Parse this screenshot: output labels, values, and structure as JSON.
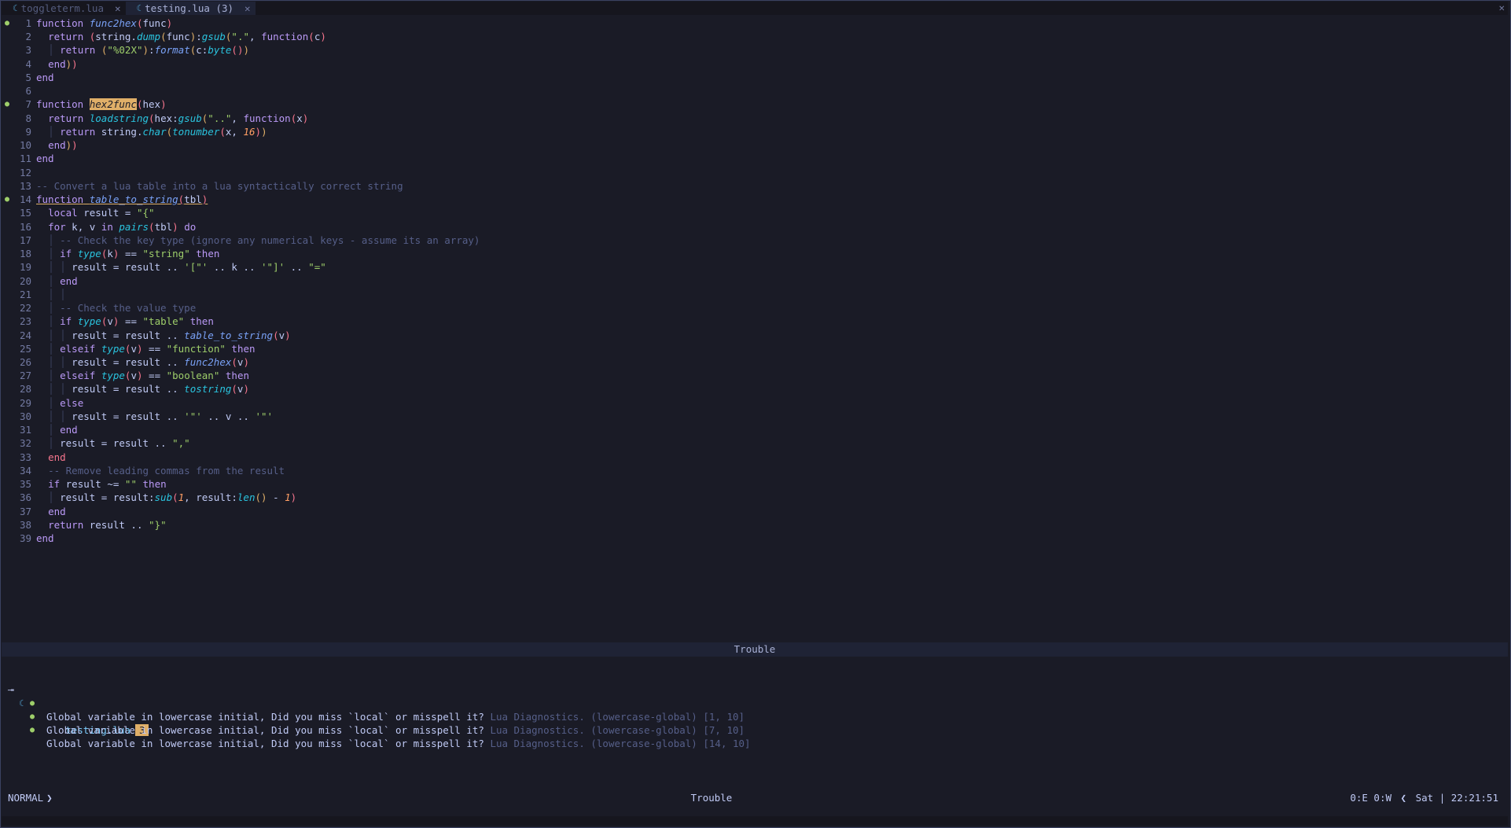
{
  "tabs": [
    {
      "label": "toggleterm.lua",
      "close": "✕",
      "active": false
    },
    {
      "label": "testing.lua (3)",
      "close": "✕",
      "active": true
    }
  ],
  "window_close": "✕",
  "icons": {
    "diagnostic": "info-icon",
    "lua": "lua-file-icon"
  },
  "colors": {
    "bg": "#1a1b26",
    "keyword": "#bb9af7",
    "string": "#9ece6a",
    "function": "#7aa2f7",
    "comment": "#565f89",
    "badge": "#e0af68"
  },
  "code_lines": [
    {
      "n": "1",
      "sign": true,
      "html": "<span class=\"kw\">function</span> <span class=\"fn\">func2hex</span><span class=\"par\">(</span>func<span class=\"par\">)</span>"
    },
    {
      "n": "2",
      "html": "  <span class=\"kw\">return</span> <span class=\"par\">(</span>string.<span class=\"bi\">dump</span><span class=\"brk\">(</span>func<span class=\"brk\">)</span>:<span class=\"bi\">gsub</span><span class=\"brk\">(</span><span class=\"str\">\".\"</span>, <span class=\"kw\">function</span><span class=\"par\">(</span>c<span class=\"par\">)</span>"
    },
    {
      "n": "3",
      "html": "  <span class=\"ig\">│</span> <span class=\"kw\">return</span> <span class=\"brk\">(</span><span class=\"str\">\"%02X\"</span><span class=\"brk\">)</span>:<span class=\"fn\">format</span><span class=\"brk\">(</span>c:<span class=\"bi\">byte</span><span class=\"par\">()</span><span class=\"brk\">)</span>"
    },
    {
      "n": "4",
      "html": "  <span class=\"kw\">end</span><span class=\"brk\">)</span><span class=\"par\">)</span>"
    },
    {
      "n": "5",
      "html": "<span class=\"kw\">end</span>"
    },
    {
      "n": "6",
      "html": ""
    },
    {
      "n": "7",
      "sign": true,
      "html": "<span class=\"kw\">function</span> <span class=\"hl\">hex2func</span><span class=\"par\">(</span>hex<span class=\"par\">)</span>"
    },
    {
      "n": "8",
      "html": "  <span class=\"kw\">return</span> <span class=\"bi\">loadstring</span><span class=\"par\">(</span>hex:<span class=\"bi\">gsub</span><span class=\"brk\">(</span><span class=\"str\">\"..\"</span>, <span class=\"kw\">function</span><span class=\"par\">(</span>x<span class=\"par\">)</span>"
    },
    {
      "n": "9",
      "html": "  <span class=\"ig\">│</span> <span class=\"kw\">return</span> string.<span class=\"bi\">char</span><span class=\"brk\">(</span><span class=\"bi\">tonumber</span><span class=\"par\">(</span>x, <span class=\"num\">16</span><span class=\"par\">)</span><span class=\"brk\">)</span>"
    },
    {
      "n": "10",
      "html": "  <span class=\"kw\">end</span><span class=\"brk\">)</span><span class=\"par\">)</span>"
    },
    {
      "n": "11",
      "html": "<span class=\"kw\">end</span>"
    },
    {
      "n": "12",
      "html": ""
    },
    {
      "n": "13",
      "html": "<span class=\"cmt\">-- Convert a lua table into a lua syntactically correct string</span>"
    },
    {
      "n": "14",
      "sign": true,
      "html": "<span class=\"under\"><span class=\"kw\">function</span> <span class=\"fn\">table_to_string</span><span class=\"par\">(</span>tbl<span class=\"par\">)</span></span>"
    },
    {
      "n": "15",
      "html": "  <span class=\"kw\">local</span> result = <span class=\"str\">\"{\"</span>"
    },
    {
      "n": "16",
      "html": "  <span class=\"kw\">for</span> k, v <span class=\"kw\">in</span> <span class=\"bi\">pairs</span><span class=\"par\">(</span>tbl<span class=\"par\">)</span> <span class=\"kw\">do</span>"
    },
    {
      "n": "17",
      "html": "  <span class=\"ig\">│</span> <span class=\"cmt\">-- Check the key type (ignore any numerical keys - assume its an array)</span>"
    },
    {
      "n": "18",
      "html": "  <span class=\"ig\">│</span> <span class=\"kw\">if</span> <span class=\"bi\">type</span><span class=\"par\">(</span>k<span class=\"par\">)</span> == <span class=\"str\">\"string\"</span> <span class=\"kw\">then</span>"
    },
    {
      "n": "19",
      "html": "  <span class=\"ig\">│</span> <span class=\"ig\">│</span> result = result .. <span class=\"str\">'[\"'</span> .. k .. <span class=\"str\">'\"]'</span> .. <span class=\"str\">\"=\"</span>"
    },
    {
      "n": "20",
      "html": "  <span class=\"ig\">│</span> <span class=\"kw\">end</span>"
    },
    {
      "n": "21",
      "html": "  <span class=\"ig\">│</span> <span class=\"ig\">│</span>"
    },
    {
      "n": "22",
      "html": "  <span class=\"ig\">│</span> <span class=\"cmt\">-- Check the value type</span>"
    },
    {
      "n": "23",
      "html": "  <span class=\"ig\">│</span> <span class=\"kw\">if</span> <span class=\"bi\">type</span><span class=\"par\">(</span>v<span class=\"par\">)</span> == <span class=\"str\">\"table\"</span> <span class=\"kw\">then</span>"
    },
    {
      "n": "24",
      "html": "  <span class=\"ig\">│</span> <span class=\"ig\">│</span> result = result .. <span class=\"fn\">table_to_string</span><span class=\"par\">(</span>v<span class=\"par\">)</span>"
    },
    {
      "n": "25",
      "html": "  <span class=\"ig\">│</span> <span class=\"kw\">elseif</span> <span class=\"bi\">type</span><span class=\"par\">(</span>v<span class=\"par\">)</span> == <span class=\"str\">\"function\"</span> <span class=\"kw\">then</span>"
    },
    {
      "n": "26",
      "html": "  <span class=\"ig\">│</span> <span class=\"ig\">│</span> result = result .. <span class=\"fn\">func2hex</span><span class=\"par\">(</span>v<span class=\"par\">)</span>"
    },
    {
      "n": "27",
      "html": "  <span class=\"ig\">│</span> <span class=\"kw\">elseif</span> <span class=\"bi\">type</span><span class=\"par\">(</span>v<span class=\"par\">)</span> == <span class=\"str\">\"boolean\"</span> <span class=\"kw\">then</span>"
    },
    {
      "n": "28",
      "html": "  <span class=\"ig\">│</span> <span class=\"ig\">│</span> result = result .. <span class=\"bi\">tostring</span><span class=\"par\">(</span>v<span class=\"par\">)</span>"
    },
    {
      "n": "29",
      "html": "  <span class=\"ig\">│</span> <span class=\"kw\">else</span>"
    },
    {
      "n": "30",
      "html": "  <span class=\"ig\">│</span> <span class=\"ig\">│</span> result = result .. <span class=\"str\">'\"'</span> .. v .. <span class=\"str\">'\"'</span>"
    },
    {
      "n": "31",
      "html": "  <span class=\"ig\">│</span> <span class=\"kw\">end</span>"
    },
    {
      "n": "32",
      "html": "  <span class=\"ig\">│</span> result = result .. <span class=\"str\">\",\"</span>"
    },
    {
      "n": "33",
      "html": "  <span class=\"kwr\">end</span>"
    },
    {
      "n": "34",
      "html": "  <span class=\"cmt\">-- Remove leading commas from the result</span>"
    },
    {
      "n": "35",
      "html": "  <span class=\"kw\">if</span> result ~= <span class=\"str\">\"\"</span> <span class=\"kw\">then</span>"
    },
    {
      "n": "36",
      "html": "  <span class=\"ig\">│</span> result = result:<span class=\"bi\">sub</span><span class=\"par\">(</span><span class=\"num\">1</span>, result:<span class=\"bi\">len</span><span class=\"brk\">()</span> - <span class=\"num\">1</span><span class=\"par\">)</span>"
    },
    {
      "n": "37",
      "html": "  <span class=\"kw\">end</span>"
    },
    {
      "n": "38",
      "html": "  <span class=\"kw\">return</span> result .. <span class=\"str\">\"}\"</span>"
    },
    {
      "n": "39",
      "html": "<span class=\"kw\">end</span>"
    }
  ],
  "trouble": {
    "title": "Trouble",
    "file": "testing.lua",
    "count": "3",
    "items": [
      {
        "msg_a": "Global variable in lowercase initial, Did you miss `local` or misspell it?",
        "src": "Lua Diagnostics. (lowercase-global)",
        "pos": "[1, 10]"
      },
      {
        "msg_a": "Global variable in lowercase initial, Did you miss `local` or misspell it?",
        "src": "Lua Diagnostics. (lowercase-global)",
        "pos": "[7, 10]"
      },
      {
        "msg_a": "Global variable in lowercase initial, Did you miss `local` or misspell it?",
        "src": "Lua Diagnostics. (lowercase-global)",
        "pos": "[14, 10]"
      }
    ]
  },
  "status": {
    "mode": "NORMAL",
    "center": "Trouble",
    "diag": "0:E 0:W",
    "day": "Sat",
    "sep": "|",
    "time": "22:21:51"
  }
}
